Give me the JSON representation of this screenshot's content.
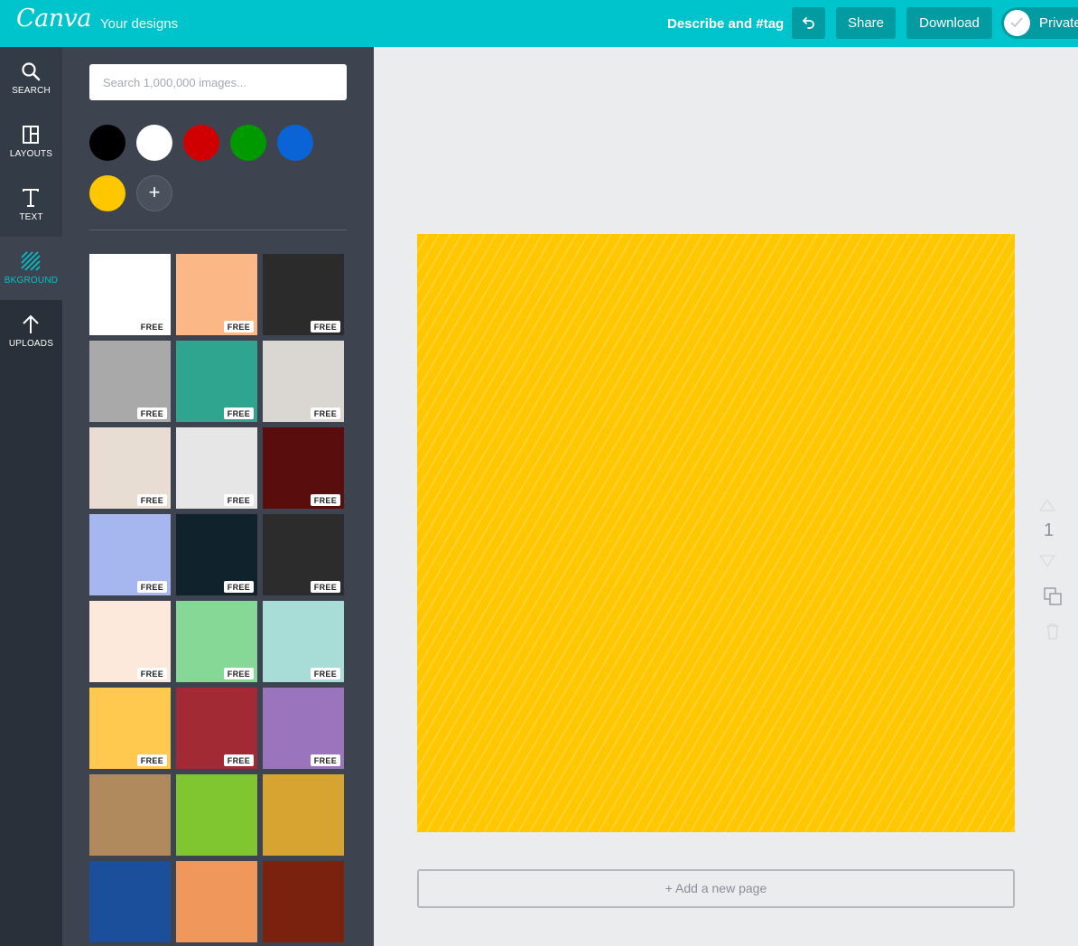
{
  "topbar": {
    "logo": "Canva",
    "your_designs": "Your designs",
    "describe": "Describe and #tag",
    "share": "Share",
    "download": "Download",
    "private": "Private",
    "accent": "#00c4cc"
  },
  "rail": {
    "items": [
      {
        "label": "SEARCH",
        "icon": "search-icon"
      },
      {
        "label": "LAYOUTS",
        "icon": "layouts-icon"
      },
      {
        "label": "TEXT",
        "icon": "text-icon"
      },
      {
        "label": "BKGROUND",
        "icon": "background-icon"
      },
      {
        "label": "UPLOADS",
        "icon": "upload-icon"
      }
    ]
  },
  "panel": {
    "search_placeholder": "Search 1,000,000 images...",
    "colors": [
      "#000000",
      "#ffffff",
      "#d10000",
      "#009a00",
      "#0a64d6",
      "#ffc700"
    ],
    "free_label": "FREE",
    "backgrounds": [
      {
        "color": "#ffffff",
        "free": true
      },
      {
        "color": "#fbb886",
        "free": true
      },
      {
        "color": "#2b2b2b",
        "free": true
      },
      {
        "color": "#a9a9a9",
        "free": true
      },
      {
        "color": "#2fa58f",
        "free": true
      },
      {
        "color": "#dad6d2",
        "free": true
      },
      {
        "color": "#e8ddd3",
        "free": true
      },
      {
        "color": "#e6e6e6",
        "free": true
      },
      {
        "color": "#5a0d0d",
        "free": true
      },
      {
        "color": "#a5b7ee",
        "free": true
      },
      {
        "color": "#10222b",
        "free": true
      },
      {
        "color": "#2c2c2c",
        "free": true
      },
      {
        "color": "#fde9dc",
        "free": true
      },
      {
        "color": "#85d896",
        "free": true
      },
      {
        "color": "#a8dcd6",
        "free": true
      },
      {
        "color": "#ffc94f",
        "free": true
      },
      {
        "color": "#a12a34",
        "free": true
      },
      {
        "color": "#9a74bd",
        "free": true
      },
      {
        "color": "#b08a5c",
        "free": false
      },
      {
        "color": "#7fc631",
        "free": false
      },
      {
        "color": "#d7a331",
        "free": false
      },
      {
        "color": "#1b4f9b",
        "free": false
      },
      {
        "color": "#f0985b",
        "free": false
      },
      {
        "color": "#7a220d",
        "free": false
      }
    ]
  },
  "canvas": {
    "background": "#ffc700",
    "add_page": "+ Add a new page",
    "page_number": "1"
  }
}
